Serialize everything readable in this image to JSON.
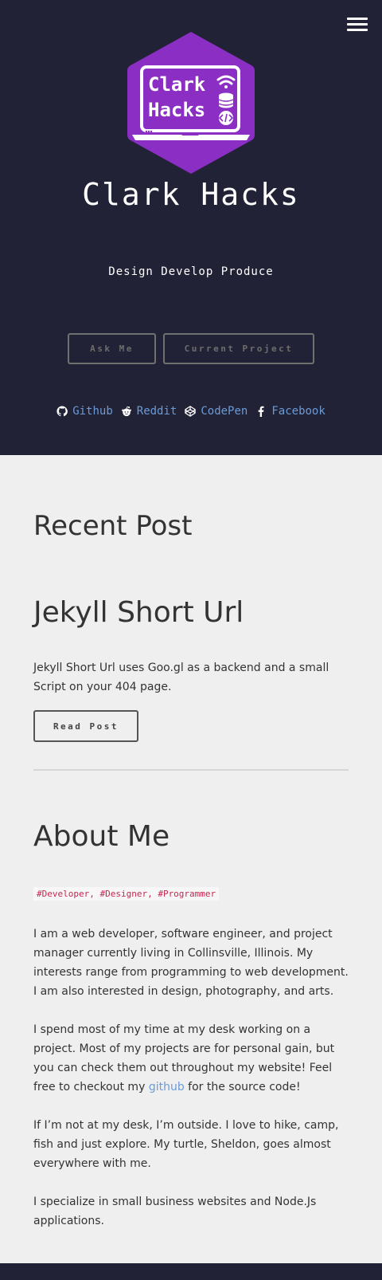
{
  "header": {
    "logo_line1": "Clark",
    "logo_line2": "Hacks",
    "site_title": "Clark Hacks",
    "tagline": "Design Develop Produce",
    "buttons": {
      "ask": "Ask Me",
      "project": "Current Project"
    },
    "social": [
      {
        "label": "Github",
        "icon": "github-icon"
      },
      {
        "label": "Reddit",
        "icon": "reddit-icon"
      },
      {
        "label": "CodePen",
        "icon": "codepen-icon"
      },
      {
        "label": "Facebook",
        "icon": "facebook-icon"
      }
    ]
  },
  "recent": {
    "heading": "Recent Post",
    "post_title": "Jekyll Short Url",
    "excerpt": "Jekyll Short Url uses Goo.gl as a backend and a small Script on your 404 page.",
    "read_button": "Read Post"
  },
  "about": {
    "heading": "About Me",
    "tags": "#Developer, #Designer, #Programmer",
    "p1": "I am a web developer, software engineer, and project manager currently living in Collinsville, Illinois. My interests range from programming to web development. I am also interested in design, photography, and arts.",
    "p2_before": "I spend most of my time at my desk working on a project. Most of my projects are for personal gain, but you can check them out throughout my website! Feel free to checkout my ",
    "p2_link": "github",
    "p2_after": " for the source code!",
    "p3": "If I’m not at my desk, I’m outside. I love to hike, camp, fish and just explore. My turtle, Sheldon, goes almost everywhere with me.",
    "p4": "I specialize in small business websites and Node.Js applications."
  },
  "colors": {
    "header_bg": "#222236",
    "logo_purple": "#8a2ec4",
    "link_blue": "#6b9bd6",
    "tag_red": "#c7254e",
    "page_bg": "#efefef"
  }
}
